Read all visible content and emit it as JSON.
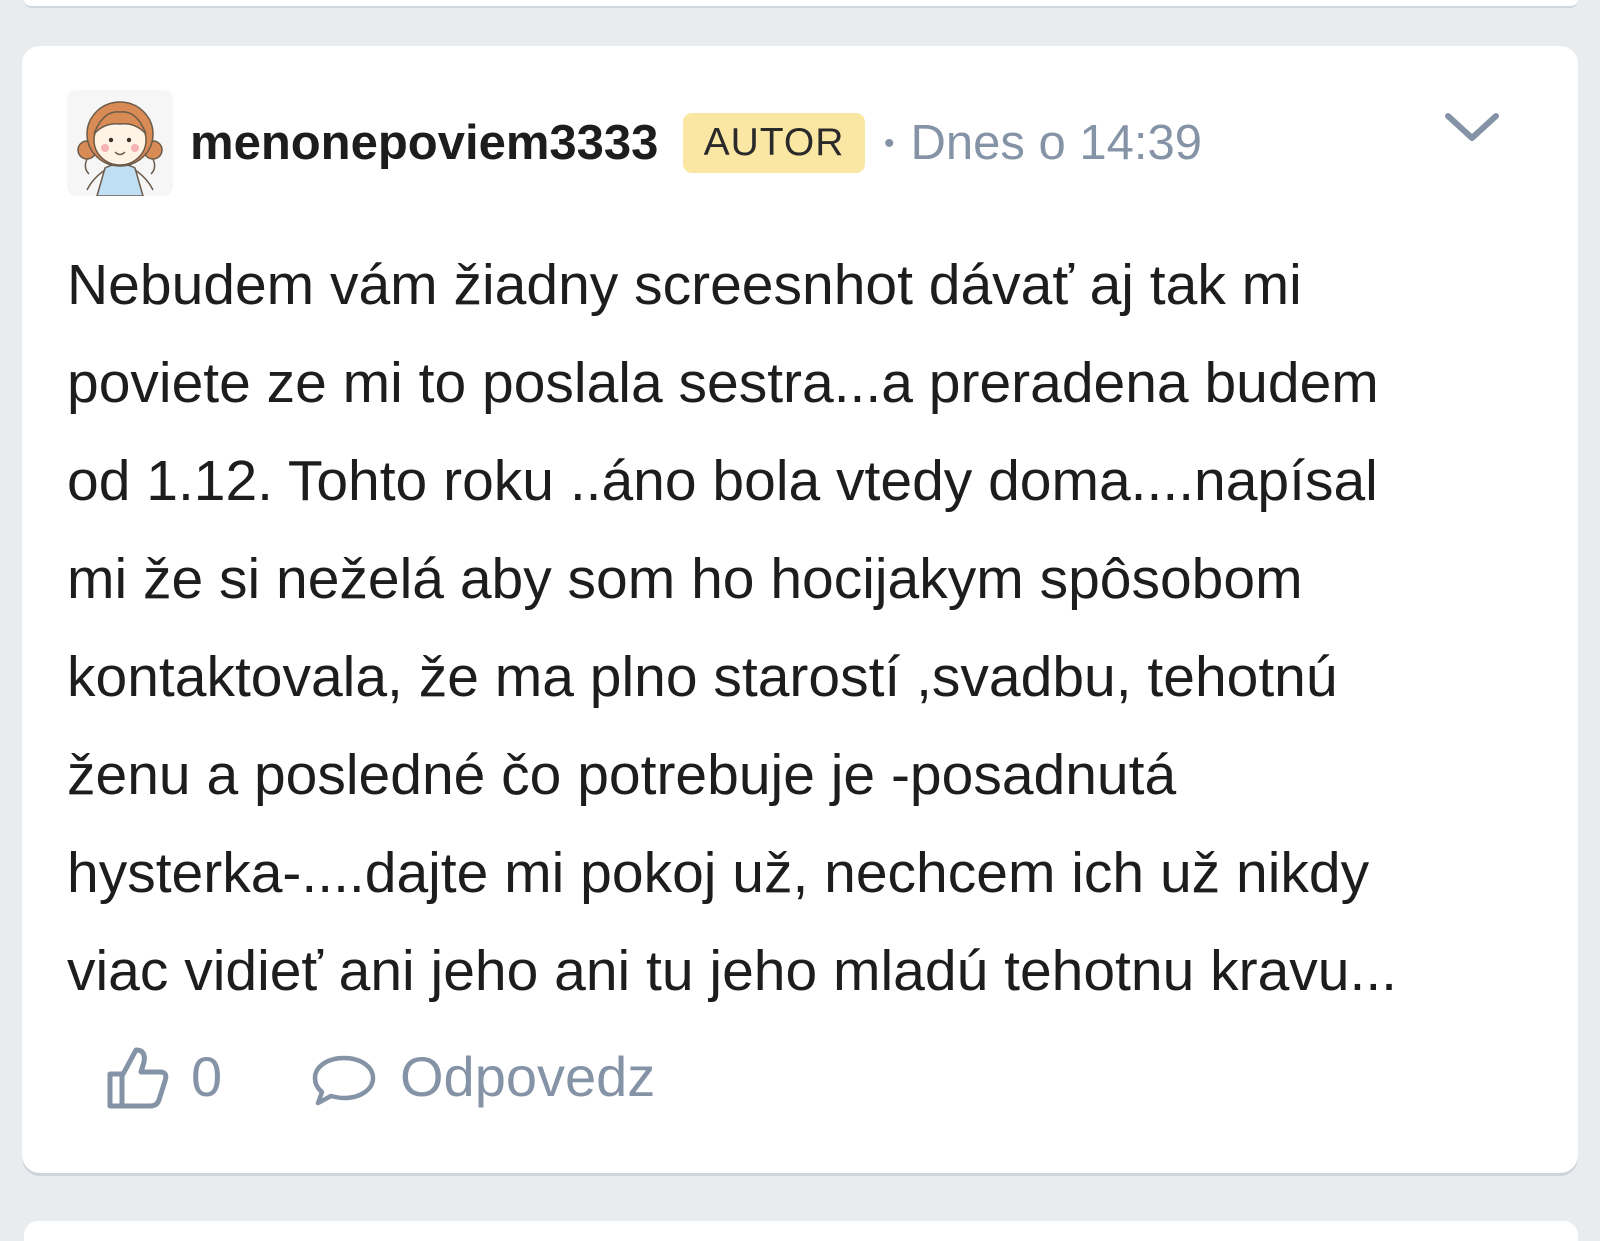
{
  "post": {
    "author": {
      "username": "menonepoviem3333",
      "badge": "AUTOR",
      "avatar_icon": "cartoon-girl-avatar"
    },
    "meta": {
      "separator": "•",
      "timestamp": "Dnes o 14:39"
    },
    "menu_icon": "chevron-down-icon",
    "body_lines": [
      "Nebudem vám žiadny screesnhot dávať aj tak mi",
      "poviete ze mi to poslala sestra...a preradena budem",
      "od 1.12. Tohto roku ..áno bola vtedy doma....napísal",
      "mi že si neželá aby som ho hocijakym spôsobom",
      "kontaktovala, že ma plno starostí ,svadbu, tehotnú",
      "ženu a posledné čo potrebuje je -posadnutá",
      "hysterka-....dajte mi pokoj už, nechcem ich už nikdy",
      "viac vidieť ani jeho ani tu jeho mladú tehotnu kravu..."
    ],
    "actions": {
      "like_icon": "thumbs-up-icon",
      "like_count": "0",
      "reply_icon": "speech-bubble-icon",
      "reply_label": "Odpovedz"
    }
  },
  "colors": {
    "page_background": "#e9ecef",
    "card_background": "#ffffff",
    "badge_background": "#fbe7a4",
    "muted_text": "#8593a6",
    "body_text": "#1d1d1d"
  }
}
